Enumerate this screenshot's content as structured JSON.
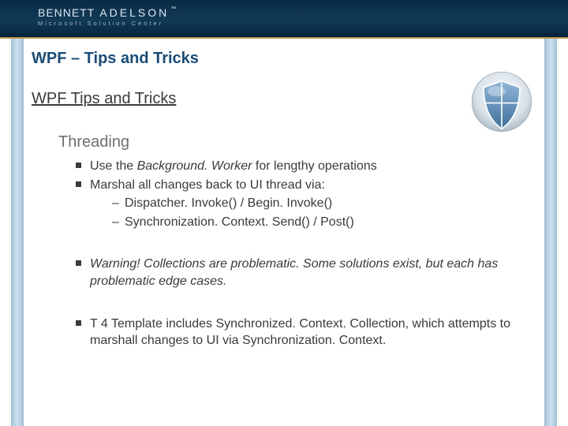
{
  "brand": {
    "name1": "BENNETT",
    "name2": "ADELSON",
    "tm": "™",
    "sub": "Microsoft Solution Center"
  },
  "title": "WPF – Tips and Tricks",
  "subtitle": "WPF Tips and Tricks",
  "section": "Threading",
  "bullets": {
    "a1_pre": "Use the ",
    "a1_it": "Background. Worker ",
    "a1_post": "for lengthy operations",
    "a2": "Marshal all changes back to UI thread via:",
    "a2_1": "Dispatcher. Invoke() / Begin. Invoke()",
    "a2_2": "Synchronization. Context. Send() / Post()",
    "b1": "Warning! Collections are problematic. Some solutions exist, but each has problematic edge cases.",
    "c1": "T 4 Template includes Synchronized. Context. Collection, which attempts to marshall changes to UI via Synchronization. Context."
  }
}
